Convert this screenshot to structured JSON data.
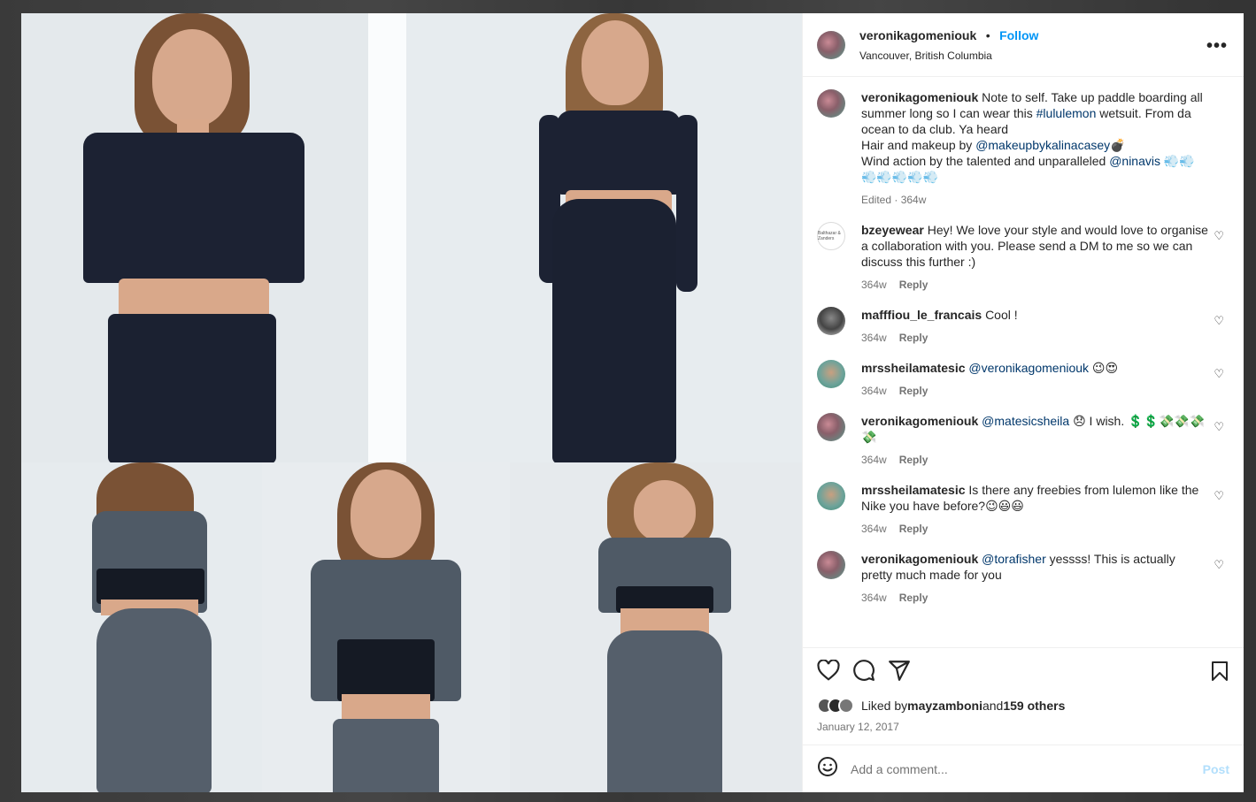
{
  "post": {
    "username": "veronikagomeniouk",
    "follow_label": "Follow",
    "location": "Vancouver, British Columbia",
    "more_label": "•••"
  },
  "caption": {
    "username": "veronikagomeniouk",
    "text_1": "Note to self. Take up paddle boarding all summer long so I can wear this ",
    "hashtag": "#lululemon",
    "text_2": " wetsuit. From da ocean to da club. Ya heard",
    "text_3": "Hair and makeup by ",
    "mention_1": "@makeupbykalinacasey",
    "emoji_1": "💣",
    "text_4": "Wind action by the talented and unparalleled ",
    "mention_2": "@ninavis",
    "emoji_2": " 💨💨💨💨💨💨💨",
    "meta": "Edited · 364w"
  },
  "comments": [
    {
      "username": "bzeyewear",
      "mention": "",
      "text": "Hey! We love your style and would love to organise a collaboration with you. Please send a DM to me so we can discuss this further :)",
      "time": "364w",
      "reply": "Reply",
      "avatar_text": "Balthazar & Zanders"
    },
    {
      "username": "mafffiou_le_francais",
      "mention": "",
      "text": "Cool !",
      "time": "364w",
      "reply": "Reply"
    },
    {
      "username": "mrssheilamatesic",
      "mention": "@veronikagomeniouk",
      "text": " 😉😍",
      "time": "364w",
      "reply": "Reply"
    },
    {
      "username": "veronikagomeniouk",
      "mention": "@matesicsheila",
      "text": " 😞 I wish. 💲💲💸💸💸💸",
      "time": "364w",
      "reply": "Reply"
    },
    {
      "username": "mrssheilamatesic",
      "mention": "",
      "text": "Is there any freebies from lulemon like the Nike you have before?😉😃😃",
      "time": "364w",
      "reply": "Reply"
    },
    {
      "username": "veronikagomeniouk",
      "mention": "@torafisher",
      "text": " yessss! This is actually pretty much made for you",
      "time": "364w",
      "reply": "Reply"
    }
  ],
  "likes": {
    "prefix": "Liked by ",
    "user": "mayzamboni",
    "middle": " and ",
    "others": "159 others"
  },
  "date": "January 12, 2017",
  "add_comment": {
    "placeholder": "Add a comment...",
    "post_label": "Post"
  },
  "colors": {
    "accent": "#0095f6",
    "mention": "#00376b",
    "outfit_navy": "#1c2233",
    "outfit_grey": "#4f5a66"
  },
  "icons": [
    "heart-icon",
    "comment-icon",
    "share-icon",
    "bookmark-icon",
    "emoji-icon",
    "more-icon"
  ]
}
